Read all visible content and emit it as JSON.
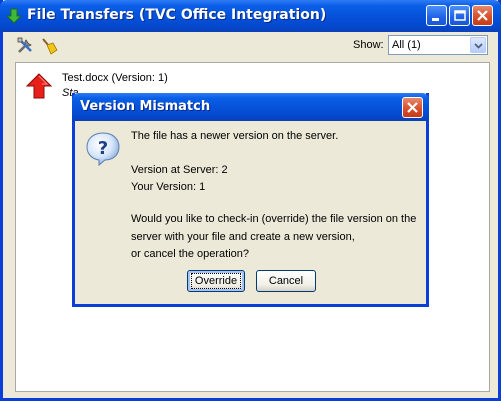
{
  "window": {
    "title": "File Transfers (TVC Office Integration)",
    "title_icon": "green-down-arrow-icon",
    "controls": [
      "minimize",
      "maximize",
      "close"
    ]
  },
  "toolbar": {
    "tools_icon": "tools-icon",
    "clean_icon": "broom-icon",
    "show_label": "Show:",
    "show_value": "All (1)"
  },
  "list": {
    "items": [
      {
        "icon": "upload-arrow-icon",
        "name": "Test.docx (Version: 1)",
        "status": "Sta"
      }
    ]
  },
  "dialog": {
    "title": "Version Mismatch",
    "icon": "question-icon",
    "line1": "The file has a newer version on the server.",
    "line2": "Version at Server: 2",
    "line3": "Your Version: 1",
    "line4": "Would you like to check-in (override) the file version on the",
    "line5": "server with your file and create a new version,",
    "line6": "or cancel the operation?",
    "override_label": "Override",
    "cancel_label": "Cancel"
  },
  "colors": {
    "titlebar": "#0654dc",
    "close_button": "#d8502d",
    "window_bg": "#ece9d8"
  }
}
